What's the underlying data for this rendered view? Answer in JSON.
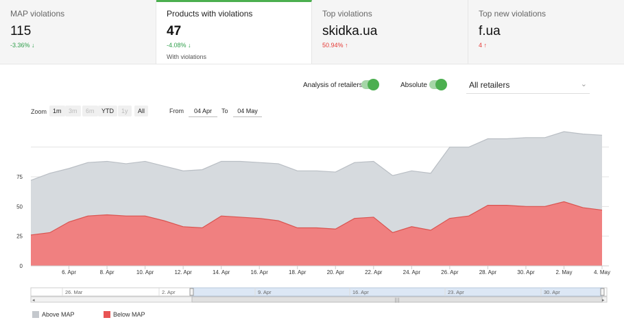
{
  "kpis": [
    {
      "title": "MAP violations",
      "value": "115",
      "change": "-3.36%",
      "arrow": "↓",
      "direction": "down",
      "sub": ""
    },
    {
      "title": "Products with violations",
      "value": "47",
      "change": "-4.08%",
      "arrow": "↓",
      "direction": "down",
      "sub": "With violations"
    },
    {
      "title": "Top violations",
      "value": "skidka.ua",
      "change": "50.94%",
      "arrow": "↑",
      "direction": "up",
      "sub": ""
    },
    {
      "title": "Top new violations",
      "value": "f.ua",
      "change": "4",
      "arrow": "↑",
      "direction": "up",
      "sub": ""
    }
  ],
  "toggles": {
    "analysis_label": "Analysis of retailers",
    "absolute_label": "Absolute",
    "analysis_on": true,
    "absolute_on": true
  },
  "retailer_select": {
    "value": "All retailers",
    "chevron_icon": "chevron-down-icon"
  },
  "zoom": {
    "label": "Zoom",
    "buttons": [
      {
        "label": "1m",
        "enabled": true
      },
      {
        "label": "3m",
        "enabled": false
      },
      {
        "label": "6m",
        "enabled": false
      },
      {
        "label": "YTD",
        "enabled": true
      },
      {
        "label": "1y",
        "enabled": false
      },
      {
        "label": "All",
        "enabled": true
      }
    ]
  },
  "range": {
    "from_label": "From",
    "from": "04 Apr",
    "to_label": "To",
    "to": "04 May"
  },
  "colors": {
    "above": "#d6dade",
    "above_line": "#b9bec4",
    "below": "#f08080",
    "below_line": "#d9534f",
    "accent": "#4caf50",
    "navigator_sel": "#dce7f5"
  },
  "chart_data": {
    "type": "area",
    "stacking": "overlay",
    "x": [
      "4. Apr",
      "5. Apr",
      "6. Apr",
      "7. Apr",
      "8. Apr",
      "9. Apr",
      "10. Apr",
      "11. Apr",
      "12. Apr",
      "13. Apr",
      "14. Apr",
      "15. Apr",
      "16. Apr",
      "17. Apr",
      "18. Apr",
      "19. Apr",
      "20. Apr",
      "21. Apr",
      "22. Apr",
      "23. Apr",
      "24. Apr",
      "25. Apr",
      "26. Apr",
      "27. Apr",
      "28. Apr",
      "29. Apr",
      "30. Apr",
      "1. May",
      "2. May",
      "3. May",
      "4. May"
    ],
    "x_tick_labels": [
      "6. Apr",
      "8. Apr",
      "10. Apr",
      "12. Apr",
      "14. Apr",
      "16. Apr",
      "18. Apr",
      "20. Apr",
      "22. Apr",
      "24. Apr",
      "26. Apr",
      "28. Apr",
      "30. Apr",
      "2. May",
      "4. May"
    ],
    "y_tick_labels": [
      "0",
      "25",
      "50",
      "75"
    ],
    "ylim": [
      0,
      120
    ],
    "grid": true,
    "series": [
      {
        "name": "Above MAP",
        "values": [
          72,
          78,
          82,
          87,
          88,
          86,
          88,
          84,
          80,
          81,
          88,
          88,
          87,
          86,
          80,
          80,
          79,
          87,
          88,
          76,
          80,
          78,
          100,
          100,
          107,
          107,
          108,
          108,
          113,
          111,
          110
        ]
      },
      {
        "name": "Below MAP",
        "values": [
          26,
          28,
          37,
          42,
          43,
          42,
          42,
          38,
          33,
          32,
          42,
          41,
          40,
          38,
          32,
          32,
          31,
          40,
          41,
          28,
          33,
          30,
          40,
          42,
          51,
          51,
          50,
          50,
          54,
          49,
          47
        ]
      }
    ],
    "legend_position": "bottom-left"
  },
  "navigator": {
    "labels": [
      "26. Mar",
      "2. Apr",
      "9. Apr",
      "16. Apr",
      "23. Apr",
      "30. Apr"
    ],
    "selection_start": "4. Apr",
    "selection_end": "4. May"
  }
}
